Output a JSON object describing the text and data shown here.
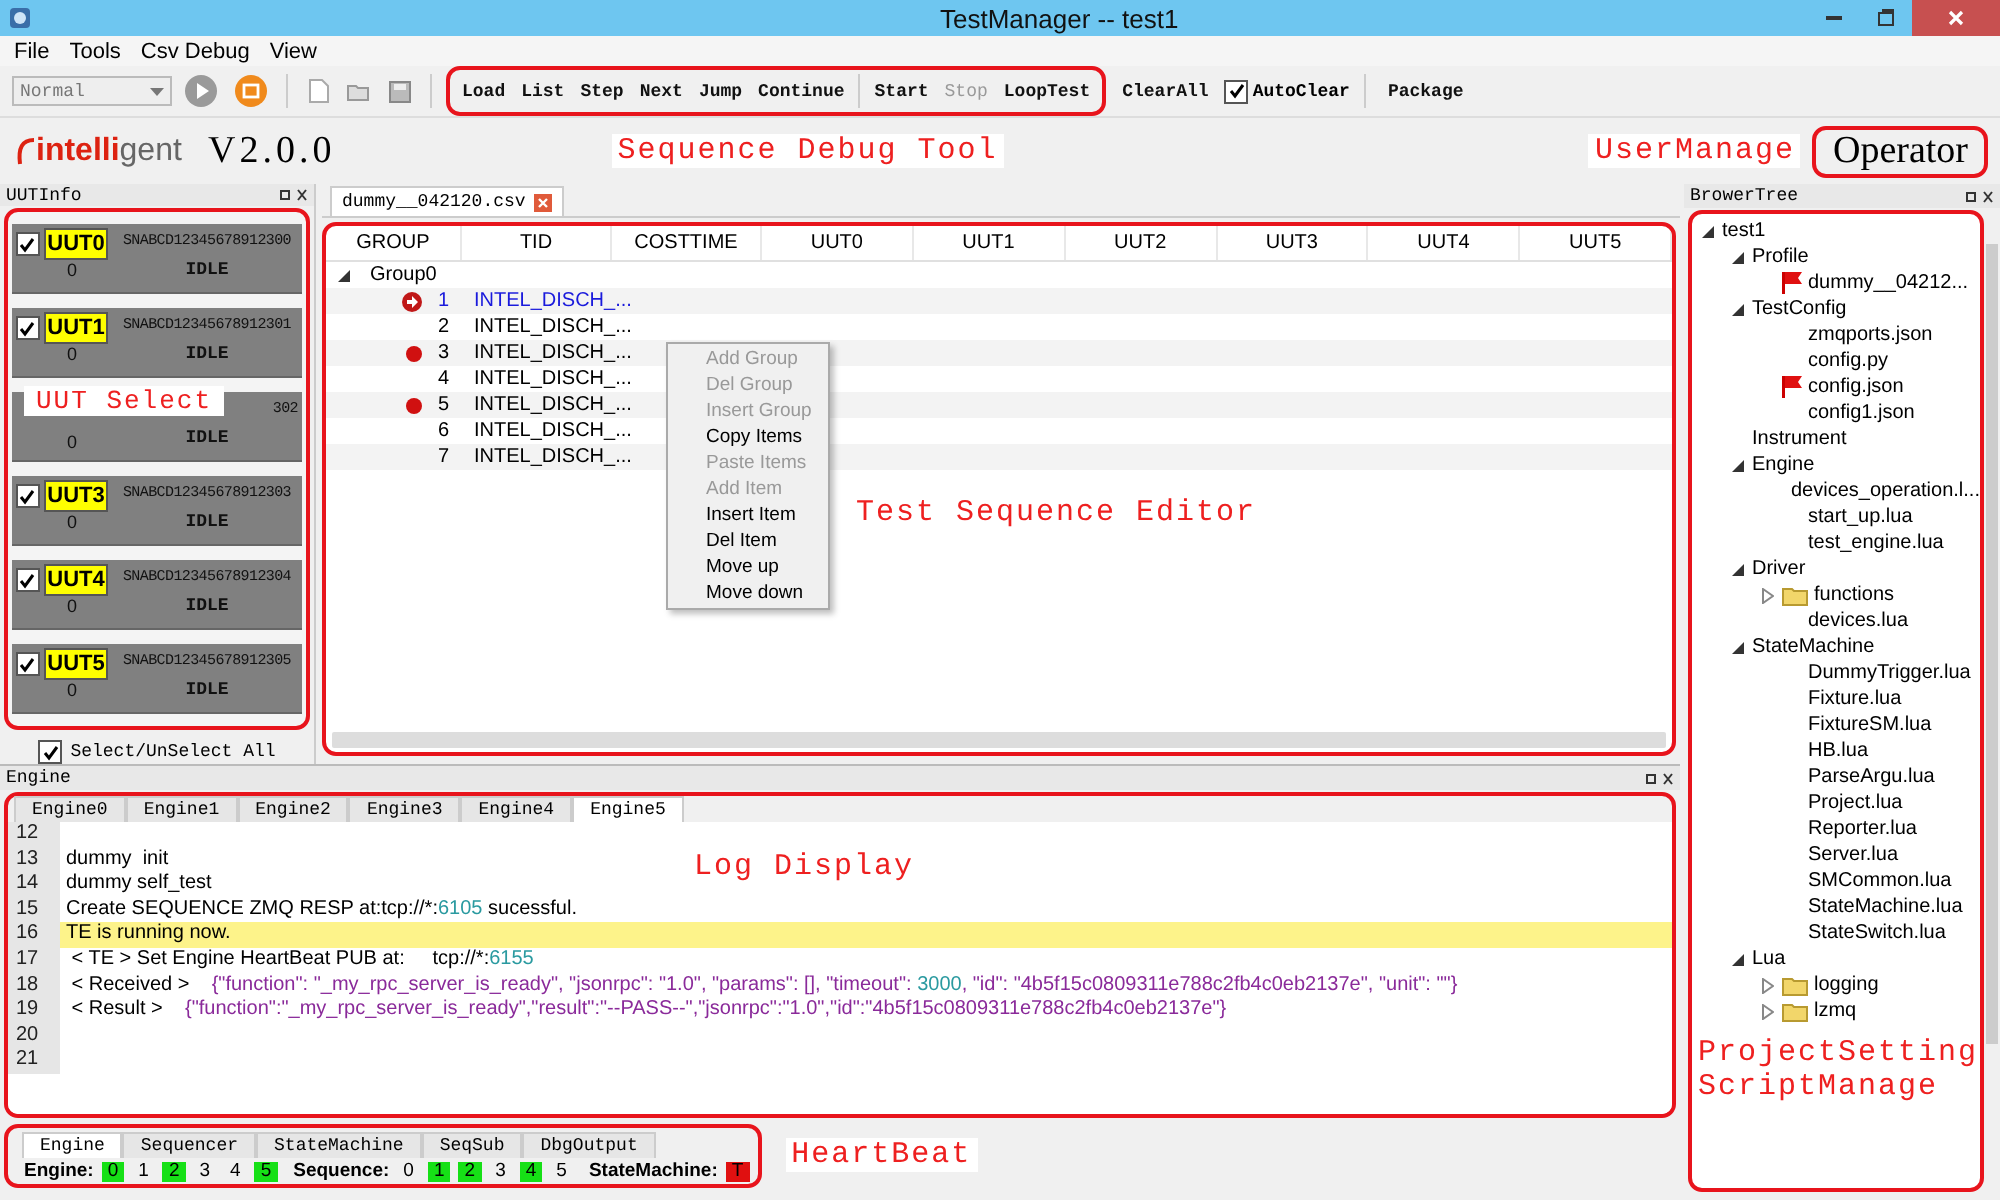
{
  "window": {
    "title": "TestManager -- test1"
  },
  "menu": [
    "File",
    "Tools",
    "Csv Debug",
    "View"
  ],
  "toolbar": {
    "mode": "Normal",
    "debug_buttons": [
      {
        "label": "Load",
        "disabled": false
      },
      {
        "label": "List",
        "disabled": false
      },
      {
        "label": "Step",
        "disabled": false
      },
      {
        "label": "Next",
        "disabled": false
      },
      {
        "label": "Jump",
        "disabled": false
      },
      {
        "label": "Continue",
        "disabled": false
      }
    ],
    "run_buttons": [
      {
        "label": "Start",
        "disabled": false
      },
      {
        "label": "Stop",
        "disabled": true
      },
      {
        "label": "LoopTest",
        "disabled": false
      }
    ],
    "clear_all": "ClearAll",
    "auto_clear": {
      "label": "AutoClear",
      "checked": true
    },
    "package": "Package"
  },
  "header": {
    "logo": [
      "intelli",
      "gent"
    ],
    "version": "V2.0.0",
    "annotation": "Sequence Debug Tool",
    "user_annotation": "UserManage",
    "user": "Operator"
  },
  "uut_panel": {
    "title": "UUTInfo",
    "annotation": "UUT Select",
    "uuts": [
      {
        "kind": "card",
        "label": "UUT0",
        "sn": "SNABCD12345678912300",
        "count": "0",
        "status": "IDLE",
        "checked": true
      },
      {
        "kind": "card",
        "label": "UUT1",
        "sn": "SNABCD12345678912301",
        "count": "0",
        "status": "IDLE",
        "checked": true
      },
      {
        "kind": "covered",
        "sn": "302",
        "count": "0",
        "status": "IDLE"
      },
      {
        "kind": "card",
        "label": "UUT3",
        "sn": "SNABCD12345678912303",
        "count": "0",
        "status": "IDLE",
        "checked": true
      },
      {
        "kind": "card",
        "label": "UUT4",
        "sn": "SNABCD12345678912304",
        "count": "0",
        "status": "IDLE",
        "checked": true
      },
      {
        "kind": "card",
        "label": "UUT5",
        "sn": "SNABCD12345678912305",
        "count": "0",
        "status": "IDLE",
        "checked": true
      }
    ],
    "select_all": {
      "label": "Select/UnSelect All",
      "checked": true
    }
  },
  "editor": {
    "tabs": [
      {
        "label": "dummy__042120.csv",
        "selected": true
      }
    ],
    "columns": [
      "GROUP",
      "TID",
      "COSTTIME",
      "UUT0",
      "UUT1",
      "UUT2",
      "UUT3",
      "UUT4",
      "UUT5"
    ],
    "group": {
      "label": "Group0",
      "expanded": true
    },
    "rows": [
      {
        "kind": "current",
        "num": "1",
        "tid": "INTEL_DISCH_..."
      },
      {
        "kind": "plain",
        "num": "2",
        "tid": "INTEL_DISCH_..."
      },
      {
        "kind": "breakpoint",
        "num": "3",
        "tid": "INTEL_DISCH_..."
      },
      {
        "kind": "plain",
        "num": "4",
        "tid": "INTEL_DISCH_..."
      },
      {
        "kind": "breakpoint",
        "num": "5",
        "tid": "INTEL_DISCH_..."
      },
      {
        "kind": "plain",
        "num": "6",
        "tid": "INTEL_DISCH_..."
      },
      {
        "kind": "plain",
        "num": "7",
        "tid": "INTEL_DISCH_..."
      }
    ],
    "context_menu": [
      {
        "label": "Add Group",
        "disabled": true
      },
      {
        "label": "Del Group",
        "disabled": true
      },
      {
        "label": "Insert Group",
        "disabled": true
      },
      {
        "label": "Copy Items",
        "disabled": false
      },
      {
        "label": "Paste Items",
        "disabled": true
      },
      {
        "label": "Add Item",
        "disabled": true
      },
      {
        "label": "Insert Item",
        "disabled": false
      },
      {
        "label": "Del Item",
        "disabled": false
      },
      {
        "label": "Move up",
        "disabled": false
      },
      {
        "label": "Move down",
        "disabled": false
      }
    ],
    "annotation": "Test Sequence Editor"
  },
  "tree": {
    "title": "BrowerTree",
    "annotation": [
      "ProjectSetting",
      "ScriptManage"
    ],
    "root": {
      "label": "test1",
      "kind": "group",
      "expanded": true,
      "children": [
        {
          "label": "Profile",
          "kind": "group",
          "expanded": true,
          "children": [
            {
              "label": "dummy__04212...",
              "kind": "file",
              "flagged": true
            }
          ]
        },
        {
          "label": "TestConfig",
          "kind": "group",
          "expanded": true,
          "children": [
            {
              "label": "zmqports.json",
              "kind": "file",
              "flagged": false
            },
            {
              "label": "config.py",
              "kind": "file",
              "flagged": false
            },
            {
              "label": "config.json",
              "kind": "file",
              "flagged": true
            },
            {
              "label": "config1.json",
              "kind": "file",
              "flagged": false
            }
          ]
        },
        {
          "label": "Instrument",
          "kind": "group"
        },
        {
          "label": "Engine",
          "kind": "group",
          "expanded": true,
          "children": [
            {
              "label": "devices_operation.l...",
              "kind": "file",
              "flagged": false
            },
            {
              "label": "start_up.lua",
              "kind": "file",
              "flagged": false
            },
            {
              "label": "test_engine.lua",
              "kind": "file",
              "flagged": false
            }
          ]
        },
        {
          "label": "Driver",
          "kind": "group",
          "expanded": true,
          "children": [
            {
              "label": "functions",
              "kind": "folder",
              "expanded": false
            },
            {
              "label": "devices.lua",
              "kind": "file",
              "flagged": false
            }
          ]
        },
        {
          "label": "StateMachine",
          "kind": "group",
          "expanded": true,
          "children": [
            {
              "label": "DummyTrigger.lua",
              "kind": "file",
              "flagged": false
            },
            {
              "label": "Fixture.lua",
              "kind": "file",
              "flagged": false
            },
            {
              "label": "FixtureSM.lua",
              "kind": "file",
              "flagged": false
            },
            {
              "label": "HB.lua",
              "kind": "file",
              "flagged": false
            },
            {
              "label": "ParseArgu.lua",
              "kind": "file",
              "flagged": false
            },
            {
              "label": "Project.lua",
              "kind": "file",
              "flagged": false
            },
            {
              "label": "Reporter.lua",
              "kind": "file",
              "flagged": false
            },
            {
              "label": "Server.lua",
              "kind": "file",
              "flagged": false
            },
            {
              "label": "SMCommon.lua",
              "kind": "file",
              "flagged": false
            },
            {
              "label": "StateMachine.lua",
              "kind": "file",
              "flagged": false
            },
            {
              "label": "StateSwitch.lua",
              "kind": "file",
              "flagged": false
            }
          ]
        },
        {
          "label": "Lua",
          "kind": "group",
          "expanded": true,
          "children": [
            {
              "label": "logging",
              "kind": "folder",
              "expanded": false
            },
            {
              "label": "lzmq",
              "kind": "folder",
              "expanded": false
            }
          ]
        }
      ]
    }
  },
  "engine_panel": {
    "title": "Engine",
    "annotation": "Log Display",
    "tabs": [
      {
        "label": "Engine0",
        "selected": false
      },
      {
        "label": "Engine1",
        "selected": false
      },
      {
        "label": "Engine2",
        "selected": false
      },
      {
        "label": "Engine3",
        "selected": false
      },
      {
        "label": "Engine4",
        "selected": false
      },
      {
        "label": "Engine5",
        "selected": true
      }
    ],
    "lines": [
      {
        "num": "12",
        "highlighted": false
      },
      {
        "num": "13",
        "highlighted": false,
        "parts": [
          {
            "kind": "plain",
            "text": "dummy  init"
          }
        ]
      },
      {
        "num": "14",
        "highlighted": false,
        "parts": [
          {
            "kind": "plain",
            "text": "dummy self_test"
          }
        ]
      },
      {
        "num": "15",
        "highlighted": false,
        "parts": [
          {
            "kind": "plain",
            "text": "Create SEQUENCE ZMQ RESP at:tcp://*:"
          },
          {
            "kind": "number",
            "text": "6105"
          },
          {
            "kind": "plain",
            "text": " sucessful."
          }
        ]
      },
      {
        "num": "16",
        "highlighted": true,
        "parts": [
          {
            "kind": "plain",
            "text": "TE is running now."
          }
        ]
      },
      {
        "num": "17",
        "highlighted": false,
        "parts": [
          {
            "kind": "plain",
            "text": " < TE > Set Engine HeartBeat PUB at:     tcp://*:"
          },
          {
            "kind": "number",
            "text": "6155"
          }
        ]
      },
      {
        "num": "18",
        "highlighted": false,
        "parts": [
          {
            "kind": "plain",
            "text": " < Received >    "
          },
          {
            "kind": "string",
            "text": "{\"function\": \"_my_rpc_server_is_ready\", \"jsonrpc\": \"1.0\", \"params\": [], \"timeout\": "
          },
          {
            "kind": "number",
            "text": "3000"
          },
          {
            "kind": "string",
            "text": ", \"id\": \"4b5f15c0809311e788c2fb4c0eb2137e\", \"unit\": \"\"}"
          }
        ]
      },
      {
        "num": "19",
        "highlighted": false,
        "parts": [
          {
            "kind": "plain",
            "text": " < Result >    "
          },
          {
            "kind": "string",
            "text": "{\"function\":\"_my_rpc_server_is_ready\",\"result\":\"--PASS--\",\"jsonrpc\":\"1.0\",\"id\":\"4b5f15c0809311e788c2fb4c0eb2137e\"}"
          }
        ]
      },
      {
        "num": "20",
        "highlighted": false
      },
      {
        "num": "21",
        "highlighted": false
      }
    ]
  },
  "heartbeat": {
    "annotation": "HeartBeat",
    "tabs": [
      {
        "label": "Engine",
        "selected": true
      },
      {
        "label": "Sequencer",
        "selected": false
      },
      {
        "label": "StateMachine",
        "selected": false
      },
      {
        "label": "SeqSub",
        "selected": false
      },
      {
        "label": "DbgOutput",
        "selected": false
      }
    ],
    "groups": [
      {
        "label": "Engine:",
        "slots": [
          {
            "text": "0",
            "color": "#16e016"
          },
          {
            "text": "1"
          },
          {
            "text": "2",
            "color": "#16e016"
          },
          {
            "text": "3"
          },
          {
            "text": "4"
          },
          {
            "text": "5",
            "color": "#16e016"
          }
        ]
      },
      {
        "label": "Sequence:",
        "slots": [
          {
            "text": "0"
          },
          {
            "text": "1",
            "color": "#16e016"
          },
          {
            "text": "2",
            "color": "#16e016"
          },
          {
            "text": "3"
          },
          {
            "text": "4",
            "color": "#16e016"
          },
          {
            "text": "5"
          }
        ]
      },
      {
        "label": "StateMachine:",
        "slots": [
          {
            "text": "T",
            "color": "#e01010"
          }
        ]
      }
    ]
  }
}
